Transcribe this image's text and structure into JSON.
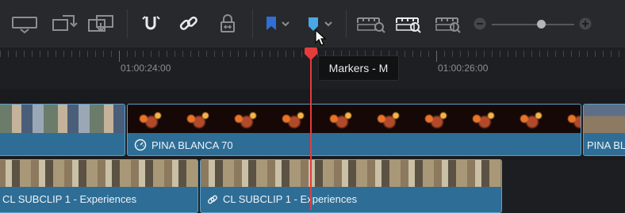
{
  "toolbar": {
    "icons": [
      "single-viewer-icon",
      "dual-viewer-icon",
      "replace-icon",
      "snapping-icon",
      "linked-selection-icon",
      "position-lock-icon",
      "flag-icon",
      "marker-icon",
      "zoom-full-icon",
      "zoom-detail-icon",
      "zoom-custom-icon",
      "zoom-out-icon",
      "zoom-in-icon"
    ],
    "zoom_level": 0.6
  },
  "ruler": {
    "timecodes": [
      "01:00:24:00",
      "01:00:26:00"
    ]
  },
  "tooltip": {
    "text": "Markers - M"
  },
  "tracks": {
    "v1": {
      "clips": [
        {
          "label": ""
        },
        {
          "label": "PINA BLANCA 70"
        },
        {
          "label": "PINA BLA"
        }
      ]
    },
    "v2": {
      "clips": [
        {
          "label": "CL SUBCLIP 1 - Experiences"
        },
        {
          "label": "CL SUBCLIP 1 - Experiences"
        }
      ]
    }
  },
  "colors": {
    "clip_fill": "#2e6e96",
    "clip_border": "#5d9fc6",
    "playhead": "#e43c3c",
    "marker_blue": "#4aa8e8",
    "flag_blue": "#2f6fd6"
  }
}
